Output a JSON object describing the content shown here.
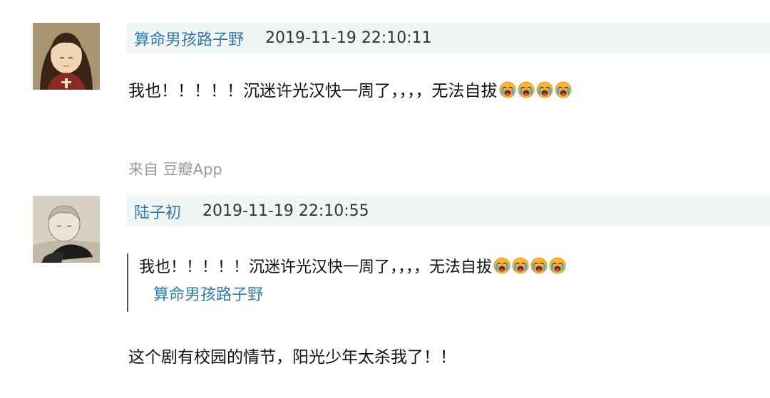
{
  "comments": [
    {
      "author": "算命男孩路子野",
      "timestamp": "2019-11-19 22:10:11",
      "text": "我也！！！！！沉迷许光汉快一周了，，，，无法自拔",
      "emoji": "loudly-crying-face",
      "emoji_count": 4,
      "source": "来自 豆瓣App"
    },
    {
      "author": "陆子初",
      "timestamp": "2019-11-19 22:10:55",
      "quote": {
        "text": "我也！！！！！沉迷许光汉快一周了，，，，无法自拔",
        "author": "算命男孩路子野"
      },
      "text": "这个剧有校园的情节，阳光少年太杀我了！！"
    }
  ],
  "colors": {
    "author_link": "#3377aa",
    "meta_background": "#f0f6f3",
    "source_text": "#999999"
  }
}
